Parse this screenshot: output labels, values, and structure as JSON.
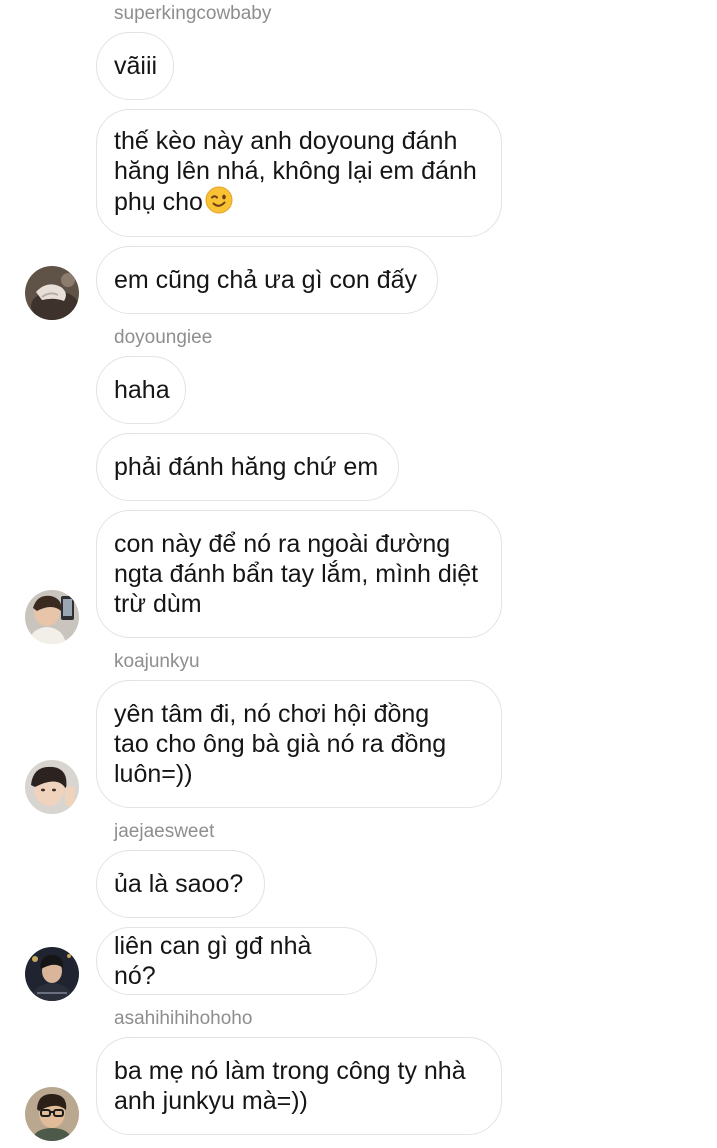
{
  "messages": [
    {
      "sender": "superkingcowbaby",
      "text": "vãiii"
    },
    {
      "text": "thế kèo này anh doyoung đánh\nhăng lên nhá, không lại em đánh\nphụ cho",
      "emoji": "wink-emoji"
    },
    {
      "text": "em cũng chả ưa gì con đấy",
      "avatar": "avatar-1"
    },
    {
      "sender": "doyoungiee",
      "text": "haha"
    },
    {
      "text": "phải đánh hăng chứ em"
    },
    {
      "text": "con này để nó ra ngoài đường\nngta đánh bẩn tay lắm, mình diệt\ntrừ dùm",
      "avatar": "avatar-2"
    },
    {
      "sender": "koajunkyu",
      "text": "yên tâm đi, nó chơi hội đồng\ntao cho ông bà già nó ra đồng\nluôn=))",
      "avatar": "avatar-3"
    },
    {
      "sender": "jaejaesweet",
      "text": "ủa là saoo?"
    },
    {
      "text": "liên can gì gđ nhà nó?",
      "avatar": "avatar-4"
    },
    {
      "sender": "asahihihihohoho",
      "text": "ba mẹ nó làm trong công ty nhà\nanh junkyu mà=))",
      "avatar": "avatar-5"
    }
  ],
  "colors": {
    "bubble_border": "#e3e3e3",
    "sender_text": "#8e8e8e",
    "message_text": "#151515",
    "background": "#ffffff"
  }
}
